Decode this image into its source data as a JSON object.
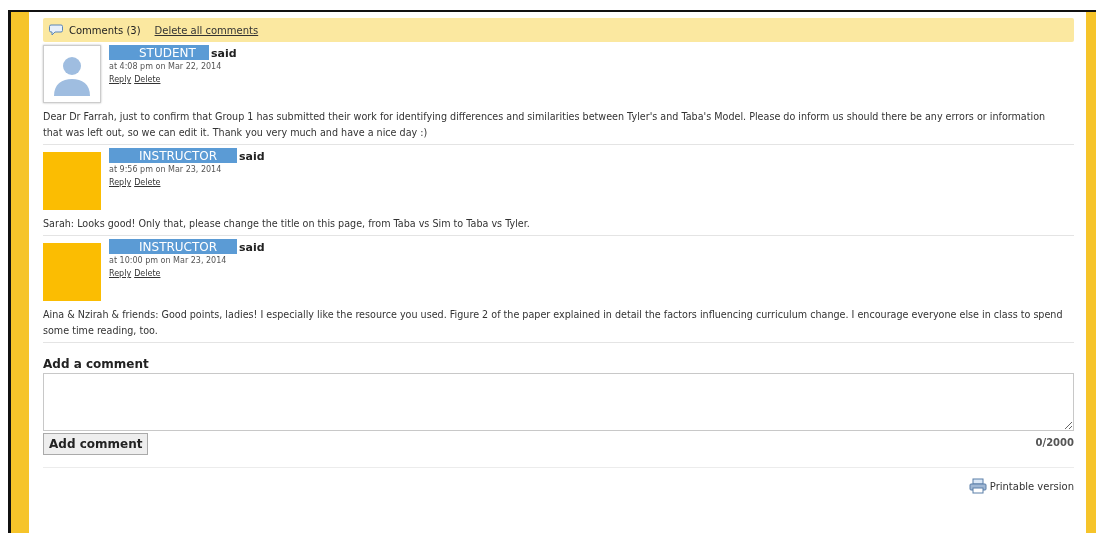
{
  "header": {
    "comments_label": "Comments (3)",
    "delete_all": "Delete all comments"
  },
  "comments": [
    {
      "role": "STUDENT",
      "said": "said",
      "avatar": {
        "kind": "silhouette"
      },
      "time": "at 4:08 pm on Mar 22, 2014",
      "actions": [
        "Reply",
        "Delete"
      ],
      "text": "Dear Dr Farrah, just to confirm that Group 1 has submitted their work for identifying differences and similarities between Tyler's and Taba's Model. Please do inform us should there be any errors or information that was left out, so we can edit it. Thank you very much and have a nice day :)"
    },
    {
      "role": "INSTRUCTOR",
      "said": "said",
      "avatar": {
        "kind": "blank"
      },
      "time": "at 9:56 pm on Mar 23, 2014",
      "actions": [
        "Reply",
        "Delete"
      ],
      "text": "Sarah: Looks good! Only that, please change the title on this page, from Taba vs Sim to Taba vs Tyler."
    },
    {
      "role": "INSTRUCTOR",
      "said": "said",
      "avatar": {
        "kind": "blank"
      },
      "time": "at 10:00 pm on Mar 23, 2014",
      "actions": [
        "Reply",
        "Delete"
      ],
      "text": "Aina & Nzirah & friends: Good points, ladies! I especially like the resource you used. Figure 2 of the paper explained in detail the factors influencing curriculum change. I encourage everyone else in class to spend some time reading, too."
    }
  ],
  "add_comment": {
    "title": "Add a comment",
    "button": "Add comment",
    "counter": "0/2000"
  },
  "footer": {
    "printable": "Printable version"
  }
}
